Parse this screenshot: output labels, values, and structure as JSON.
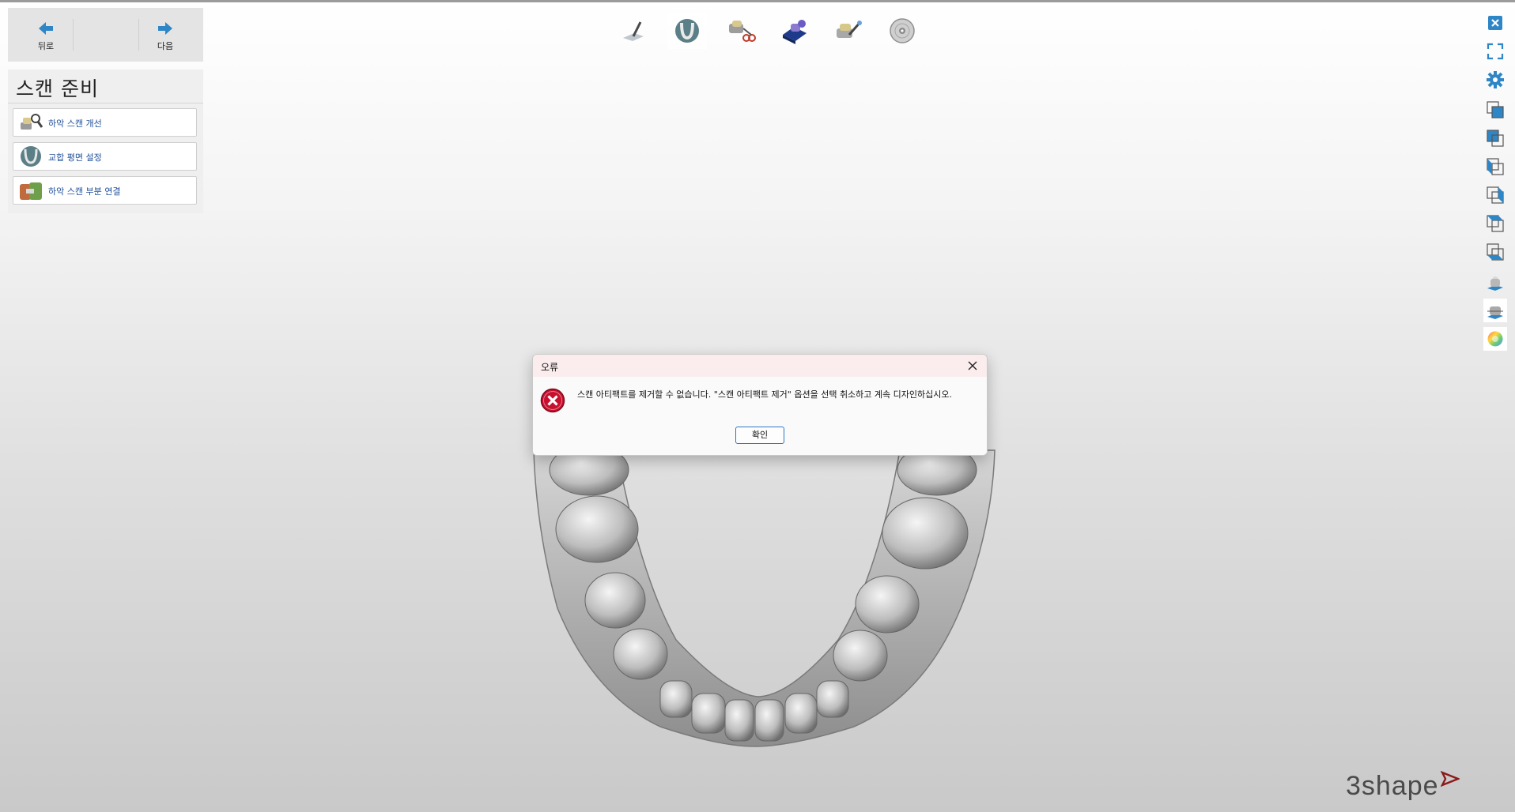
{
  "nav": {
    "back_label": "뒤로",
    "next_label": "다음"
  },
  "step_panel": {
    "title": "스캔 준비",
    "items": [
      {
        "label": "하악 스캔 개선",
        "icon": "scan-refine-icon"
      },
      {
        "label": "교합 평면 설정",
        "icon": "occlusal-plane-icon"
      },
      {
        "label": "하악 스캔 부분 연결",
        "icon": "scan-connect-icon"
      }
    ]
  },
  "toolbar": {
    "items": [
      {
        "icon": "cut-plane-icon"
      },
      {
        "icon": "dental-arch-icon"
      },
      {
        "icon": "scissors-tool-icon"
      },
      {
        "icon": "model-base-icon"
      },
      {
        "icon": "scan-tool-icon"
      },
      {
        "icon": "disc-icon"
      }
    ]
  },
  "right_toolbar": {
    "items": [
      "close-view-icon",
      "fullscreen-icon",
      "settings-gear-icon",
      "view-front-icon",
      "view-back-icon",
      "view-left-icon",
      "view-right-icon",
      "view-top-icon",
      "view-bottom-icon",
      "model-view-icon",
      "model-section-icon",
      "color-wheel-icon"
    ]
  },
  "dialog": {
    "title": "오류",
    "message": "스캔 아티팩트를 제거할 수 없습니다. \"스캔 아티팩트 제거\" 옵션을 선택 취소하고 계속 디자인하십시오.",
    "ok_label": "확인",
    "error_color": "#c8102e"
  },
  "brand": {
    "logo_text": "3shape",
    "accent": "#8b1a1a"
  },
  "colors": {
    "link": "#1f4f9a",
    "nav_arrow": "#2f86c6"
  }
}
